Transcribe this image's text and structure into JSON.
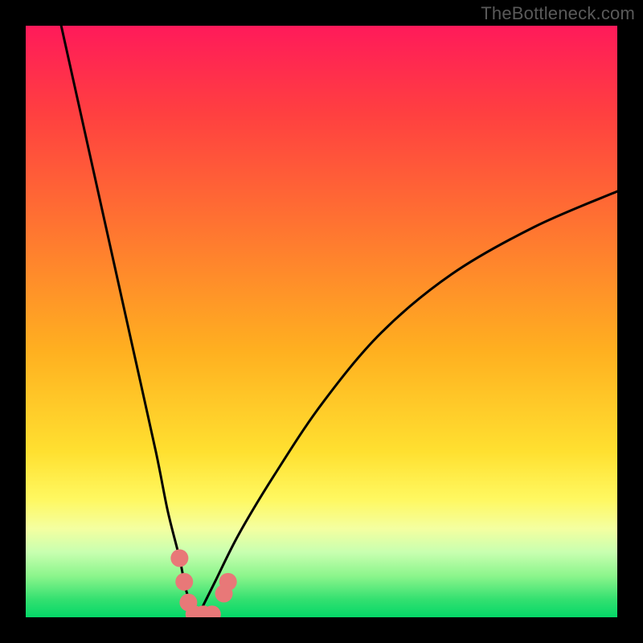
{
  "watermark": "TheBottleneck.com",
  "chart_data": {
    "type": "line",
    "title": "",
    "xlabel": "",
    "ylabel": "",
    "xlim": [
      0,
      100
    ],
    "ylim": [
      0,
      100
    ],
    "series": [
      {
        "name": "bottleneck-curve",
        "x": [
          6,
          10,
          14,
          18,
          22,
          24,
          26,
          27,
          28,
          29,
          30,
          32,
          36,
          42,
          50,
          60,
          72,
          86,
          100
        ],
        "values": [
          100,
          82,
          64,
          46,
          28,
          18,
          10,
          5,
          2,
          0,
          2,
          6,
          14,
          24,
          36,
          48,
          58,
          66,
          72
        ]
      }
    ],
    "markers": {
      "name": "highlight-dots",
      "color": "#e87878",
      "points": [
        {
          "x": 26.0,
          "y": 10
        },
        {
          "x": 26.8,
          "y": 6
        },
        {
          "x": 27.5,
          "y": 2.5
        },
        {
          "x": 28.5,
          "y": 0.5
        },
        {
          "x": 30.0,
          "y": 0.5
        },
        {
          "x": 31.5,
          "y": 0.5
        },
        {
          "x": 33.5,
          "y": 4
        },
        {
          "x": 34.2,
          "y": 6
        }
      ]
    }
  }
}
